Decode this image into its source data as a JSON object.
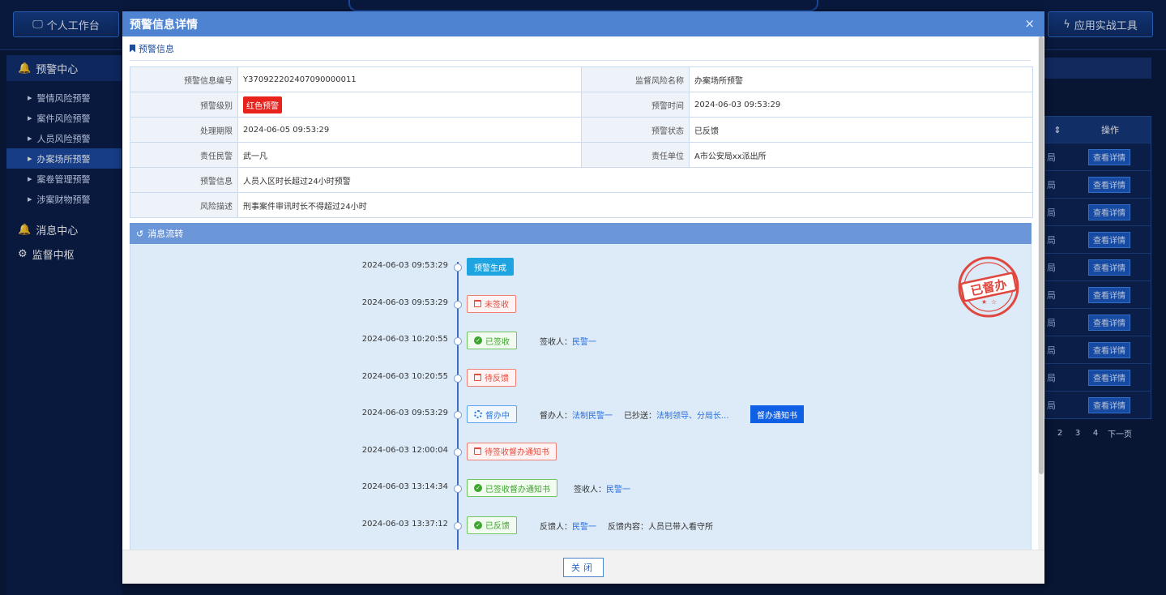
{
  "top": {
    "left_btn": "个人工作台",
    "right_btn": "应用实战工具"
  },
  "sidebar": {
    "group1": "预警中心",
    "items": [
      "警情风险预警",
      "案件风险预警",
      "人员风险预警",
      "办案场所预警",
      "案卷管理预警",
      "涉案财物预警"
    ],
    "group2": "消息中心",
    "group3": "监督中枢"
  },
  "bg_table": {
    "op_header": "操作",
    "row_cut": "局",
    "row_btn": "查看详情",
    "pager": [
      "2",
      "3",
      "4",
      "下一页"
    ]
  },
  "modal": {
    "title": "预警信息详情",
    "close_icon": "×",
    "section_info": "预警信息",
    "fields": {
      "code_label": "预警信息编号",
      "code": "Y370922202407090000011",
      "risk_name_label": "监督风险名称",
      "risk_name": "办案场所预警",
      "level_label": "预警级别",
      "level": "红色预警",
      "time_label": "预警时间",
      "time": "2024-06-03 09:53:29",
      "deadline_label": "处理期限",
      "deadline": "2024-06-05 09:53:29",
      "status_label": "预警状态",
      "status": "已反馈",
      "police_label": "责任民警",
      "police": "武一凡",
      "unit_label": "责任单位",
      "unit": "A市公安局xx派出所",
      "info_label": "预警信息",
      "info": "人员入区时长超过24小时预警",
      "desc_label": "风险描述",
      "desc": "刑事案件审讯时长不得超过24小时"
    },
    "section_flow": "消息流转",
    "stamp_text": "已督办",
    "events": [
      {
        "time": "2024-06-03 09:53:29",
        "tag": "预警生成"
      },
      {
        "time": "2024-06-03 09:53:29",
        "tag": "未签收"
      },
      {
        "time": "2024-06-03 10:20:55",
        "tag": "已签收",
        "k1": "签收人：",
        "v1": "民警一"
      },
      {
        "time": "2024-06-03 10:20:55",
        "tag": "待反馈"
      },
      {
        "time": "2024-06-03 09:53:29",
        "tag": "督办中",
        "k1": "督办人：",
        "v1": "法制民警一",
        "k2": "已抄送：",
        "v2": "法制领导、分局长...",
        "btn": "督办通知书"
      },
      {
        "time": "2024-06-03 12:00:04",
        "tag": "待签收督办通知书"
      },
      {
        "time": "2024-06-03 13:14:34",
        "tag": "已签收督办通知书",
        "k1": "签收人：",
        "v1": "民警一"
      },
      {
        "time": "2024-06-03 13:37:12",
        "tag": "已反馈",
        "k1": "反馈人：",
        "v1": "民警一",
        "k2": "反馈内容：",
        "v2": "人员已带入看守所"
      }
    ],
    "close_btn": "关闭"
  }
}
